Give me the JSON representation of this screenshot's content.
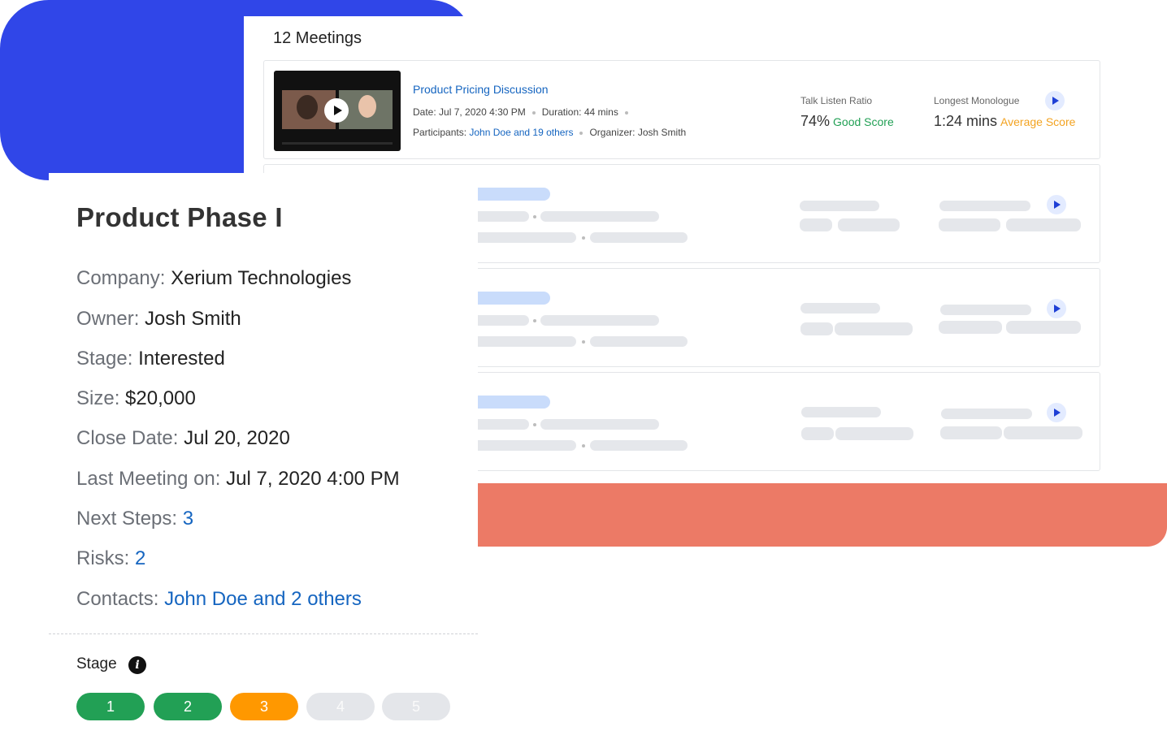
{
  "meetings": {
    "title": "12 Meetings",
    "first": {
      "title": "Product Pricing Discussion",
      "date_label": "Date:",
      "date": "Jul 7, 2020 4:30 PM",
      "duration_label": "Duration:",
      "duration": "44 mins",
      "participants_label": "Participants:",
      "participants": "John Doe and 19 others",
      "organizer_label": "Organizer:",
      "organizer": "Josh Smith",
      "talk_listen_label": "Talk Listen Ratio",
      "talk_listen_value": "74%",
      "talk_listen_score": "Good Score",
      "monologue_label": "Longest Monologue",
      "monologue_value": "1:24 mins",
      "monologue_score": "Average Score"
    }
  },
  "deal": {
    "title": "Product Phase I",
    "company_label": "Company:",
    "company": "Xerium Technologies",
    "owner_label": "Owner:",
    "owner": "Josh Smith",
    "stage_label": "Stage:",
    "stage": "Interested",
    "size_label": "Size:",
    "size": "$20,000",
    "close_label": "Close Date:",
    "close": "Jul 20, 2020",
    "last_meeting_label": "Last Meeting on:",
    "last_meeting": "Jul 7, 2020 4:00 PM",
    "next_steps_label": "Next Steps:",
    "next_steps": "3",
    "risks_label": "Risks:",
    "risks": "2",
    "contacts_label": "Contacts:",
    "contacts": "John Doe and 2 others"
  },
  "stage_section": {
    "label": "Stage",
    "info_icon": "i",
    "steps": [
      "1",
      "2",
      "3",
      "4",
      "5"
    ],
    "current_step": 3
  },
  "colors": {
    "blue_blob": "#3046e8",
    "coral_blob": "#ec7a66",
    "link": "#1565c0",
    "good": "#22a055",
    "average": "#f3a321"
  }
}
